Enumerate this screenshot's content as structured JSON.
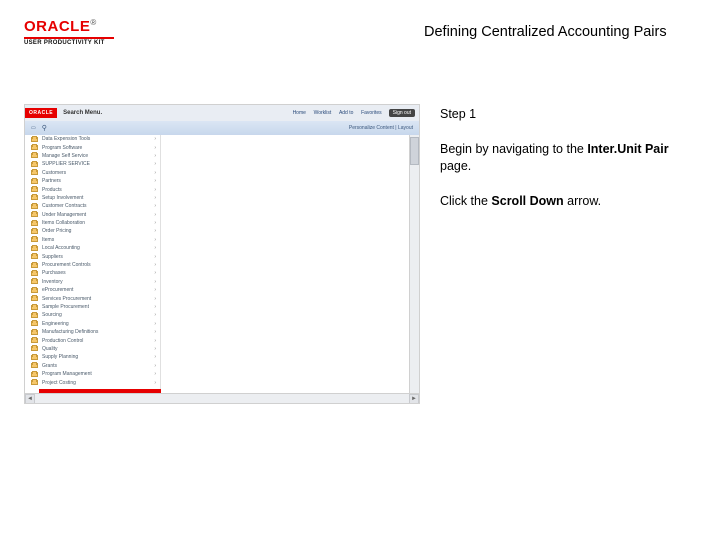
{
  "brand": {
    "logo_text": "ORACLE",
    "subline": "USER PRODUCTIVITY KIT"
  },
  "page_title": "Defining Centralized Accounting Pairs",
  "instructions": {
    "step_label": "Step 1",
    "line1_prefix": "Begin by navigating to the ",
    "line1_bold": "Inter.Unit Pair",
    "line1_suffix": " page.",
    "line2_prefix": "Click the ",
    "line2_bold": "Scroll Down",
    "line2_suffix": " arrow."
  },
  "app": {
    "mini_logo": "ORACLE",
    "search_label": "Search Menu.",
    "nav_links": [
      "Home",
      "Worklist",
      "Add to",
      "Favorites"
    ],
    "signout": "Sign out",
    "breadcrumb": "Personalize Content | Layout",
    "sidebar_items": [
      "Data Expension Tools",
      "Program Software",
      "Manage Self Service",
      "SUPPLIER SERVICE",
      "Customers",
      "Partners",
      "Products",
      "Setup Involvement",
      "Customer Contracts",
      "Under Management",
      "Items Collaboration",
      "Order Pricing",
      "Items",
      "Local Accounting",
      "Suppliers",
      "Procurement Controls",
      "Purchases",
      "Inventory",
      "eProcurement",
      "Services Procurement",
      "Sample Procurement",
      "Sourcing",
      "Engineering",
      "Manufacturing Definitions",
      "Production Control",
      "Quality",
      "Supply Planning",
      "Grants",
      "Program Management",
      "Project Costing"
    ]
  }
}
